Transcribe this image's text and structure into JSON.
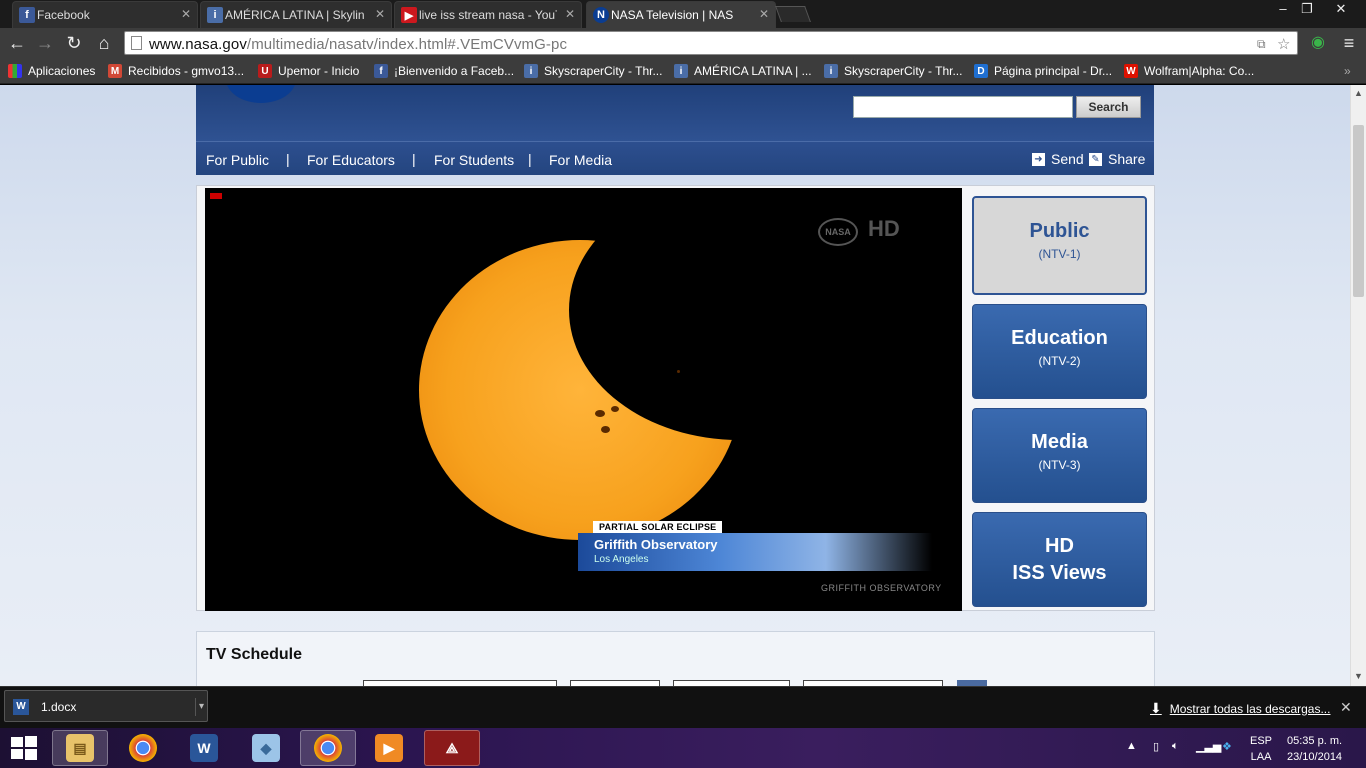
{
  "browser": {
    "tabs": [
      {
        "title": "Facebook",
        "icon": "f",
        "color": "#3b5998"
      },
      {
        "title": "AMÉRICA LATINA | Skylin",
        "icon": "i",
        "color": "#4a6da7"
      },
      {
        "title": "live iss stream nasa - YouT",
        "icon": "▶",
        "color": "#cc181e"
      },
      {
        "title": "NASA Television | NAS",
        "icon": "N",
        "color": "#0b3d91"
      }
    ],
    "window_controls": {
      "minimize": "–",
      "restore": "❐",
      "close": "✕"
    },
    "url_host": "www.nasa.gov",
    "url_path": "/multimedia/nasatv/index.html#.VEmCVvmG-pc",
    "bookmarks": [
      {
        "label": "Aplicaciones",
        "icon": "apps-icon",
        "color": "#d33"
      },
      {
        "label": "Recibidos - gmvo13...",
        "icon": "M",
        "color": "#d14836"
      },
      {
        "label": "Upemor - Inicio",
        "icon": "U",
        "color": "#b91c1c"
      },
      {
        "label": "¡Bienvenido a Faceb...",
        "icon": "f",
        "color": "#3b5998"
      },
      {
        "label": "SkyscraperCity - Thr...",
        "icon": "i",
        "color": "#4a6da7"
      },
      {
        "label": "AMÉRICA LATINA | ...",
        "icon": "i",
        "color": "#4a6da7"
      },
      {
        "label": "SkyscraperCity - Thr...",
        "icon": "i",
        "color": "#4a6da7"
      },
      {
        "label": "Página principal - Dr...",
        "icon": "D",
        "color": "#1f6fd1"
      },
      {
        "label": "Wolfram|Alpha: Co...",
        "icon": "W",
        "color": "#dd1100"
      }
    ],
    "bookmarks_more": "»"
  },
  "nasa": {
    "search_button": "Search",
    "nav": [
      "For Public",
      "For Educators",
      "For Students",
      "For Media"
    ],
    "nav_separator": "|",
    "send_label": "Send",
    "share_label": "Share",
    "video": {
      "hd_label": "HD",
      "nasa_bug": "NASA",
      "lower_third_tag": "PARTIAL SOLAR ECLIPSE",
      "lower_third_title": "Griffith Observatory",
      "lower_third_sub": "Los Angeles",
      "credit": "GRIFFITH OBSERVATORY"
    },
    "channels": [
      {
        "name": "Public",
        "sub": "(NTV-1)",
        "active": true
      },
      {
        "name": "Education",
        "sub": "(NTV-2)",
        "active": false
      },
      {
        "name": "Media",
        "sub": "(NTV-3)",
        "active": false
      },
      {
        "name": "HD",
        "name2": "ISS Views",
        "active": false
      }
    ],
    "schedule_title": "TV Schedule"
  },
  "downloads": {
    "file": "1.docx",
    "show_all": "Mostrar todas las descargas..."
  },
  "taskbar": {
    "lang_1": "ESP",
    "lang_2": "LAA",
    "time": "05:35 p. m.",
    "date": "23/10/2014"
  }
}
